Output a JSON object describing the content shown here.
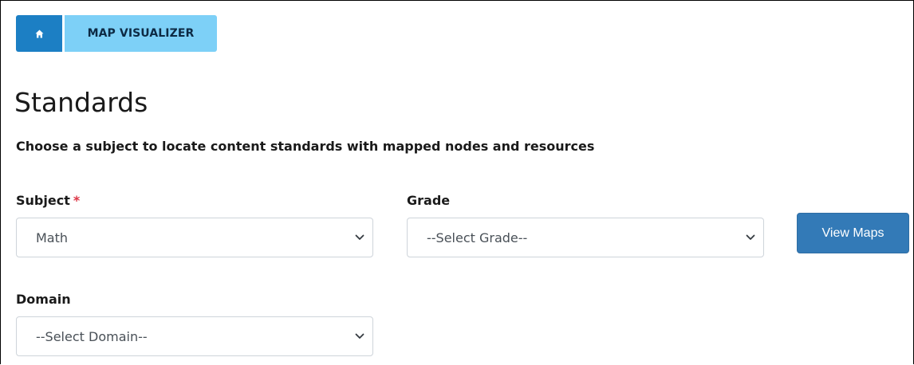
{
  "breadcrumb": {
    "home_icon": "home-icon",
    "current": "MAP VISUALIZER"
  },
  "page": {
    "title": "Standards",
    "subtitle": "Choose a subject to locate content standards with mapped nodes and resources"
  },
  "form": {
    "subject": {
      "label": "Subject",
      "required_marker": "*",
      "value": "Math"
    },
    "grade": {
      "label": "Grade",
      "value": "--Select Grade--"
    },
    "domain": {
      "label": "Domain",
      "value": "--Select Domain--"
    },
    "view_button": "View Maps"
  },
  "colors": {
    "home_button": "#1c7fc4",
    "breadcrumb_crumb": "#7dd0f7",
    "primary_button": "#337ab7",
    "required": "#dc3545"
  }
}
